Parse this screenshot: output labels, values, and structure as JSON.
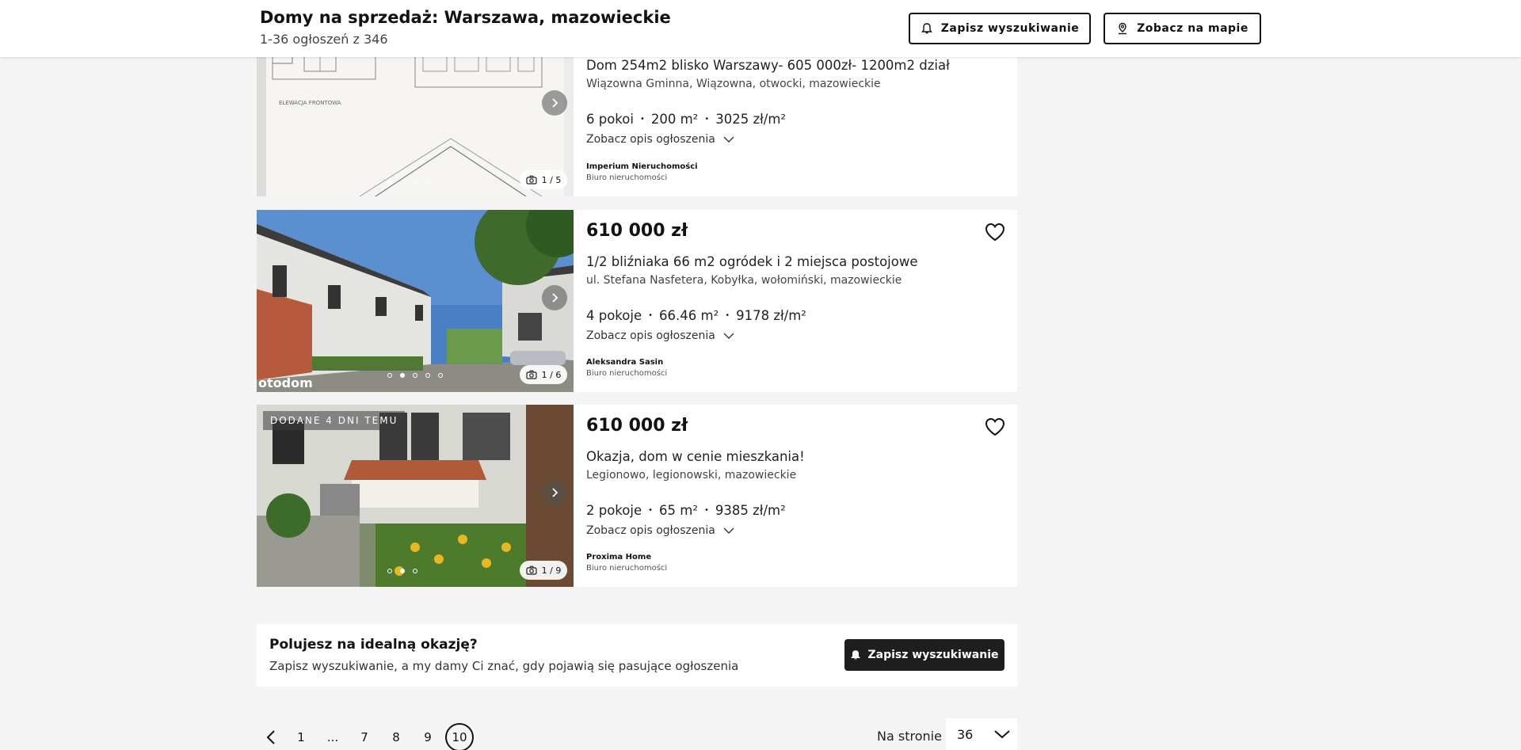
{
  "header": {
    "title": "Domy na sprzedaż: Warszawa, mazowieckie",
    "count": "1-36 ogłoszeń z 346",
    "save_search": "Zapisz wyszukiwanie",
    "map": "Zobacz na mapie"
  },
  "listings": [
    {
      "title": "Dom 254m2 blisko Warszawy- 605 000zł- 1200m2 dział",
      "address": "Wiązowna Gminna, Wiązowna, otwocki, mazowieckie",
      "rooms": "6 pokoi",
      "area": "200 m²",
      "price_per_m": "3025 zł/m²",
      "desc_label": "Zobacz opis ogłoszenia",
      "agency": "Imperium Nieruchomości",
      "agency_type": "Biuro nieruchomości",
      "photo_counter": "1 / 5",
      "photo_index": 0,
      "photo_dots": 4
    },
    {
      "price": "610 000 zł",
      "title": "1/2 bliźniaka 66 m2 ogródek i 2 miejsca postojowe",
      "address": "ul. Stefana Nasfetera, Kobyłka, wołomiński, mazowieckie",
      "rooms": "4 pokoje",
      "area": "66.46 m²",
      "price_per_m": "9178 zł/m²",
      "desc_label": "Zobacz opis ogłoszenia",
      "agency": "Aleksandra Sasin",
      "agency_type": "Biuro nieruchomości",
      "photo_counter": "1 / 6",
      "watermark": "otodom",
      "photo_index": 1,
      "photo_dots": 5
    },
    {
      "price": "610 000 zł",
      "badge": "DODANE 4 DNI TEMU",
      "title": "Okazja, dom w cenie mieszkania!",
      "address": "Legionowo, legionowski, mazowieckie",
      "rooms": "2 pokoje",
      "area": "65 m²",
      "price_per_m": "9385 zł/m²",
      "desc_label": "Zobacz opis ogłoszenia",
      "agency": "Proxima Home",
      "agency_type": "Biuro nieruchomości",
      "photo_counter": "1 / 9",
      "photo_index": 1,
      "photo_dots": 3
    }
  ],
  "banner": {
    "title": "Polujesz na idealną okazję?",
    "subtitle": "Zapisz wyszukiwanie, a my damy Ci znać, gdy pojawią się pasujące ogłoszenia",
    "button": "Zapisz wyszukiwanie"
  },
  "pagination": {
    "pages": [
      "1",
      "...",
      "7",
      "8",
      "9",
      "10"
    ],
    "active": "10",
    "per_page_label": "Na stronie",
    "per_page_value": "36"
  },
  "colors": {
    "accent": "#121212",
    "background": "#f4f4f4",
    "card": "#ffffff"
  }
}
